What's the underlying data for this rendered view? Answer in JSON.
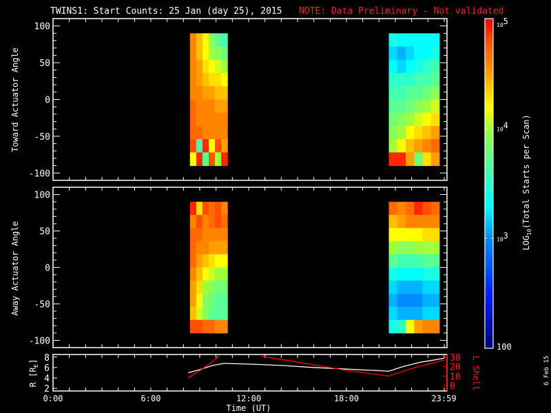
{
  "title": {
    "main": "TWINS1: Start Counts: 25 Jan (day  25), 2015",
    "note": "NOTE: Data Preliminary - Not validated"
  },
  "side_date": "6 Feb 15",
  "colors": {
    "axis": "#ffffff",
    "lshell": "#ff0000",
    "background": "#000000"
  },
  "chart_data": [
    {
      "type": "heatmap",
      "name": "toward",
      "ylabel": "Toward Actuator Angle",
      "ylim": [
        -110,
        110
      ],
      "yticks": [
        -100,
        -50,
        0,
        50,
        100
      ],
      "xlim": [
        0,
        24
      ],
      "angle_bins": [
        90,
        72,
        54,
        36,
        18,
        0,
        -18,
        -36,
        -54,
        -72,
        -90
      ],
      "blocks": [
        {
          "t_start": 8.4,
          "t_end": 10.7,
          "log_values": [
            [
              4.6,
              4.4,
              4.2,
              3.9,
              3.7,
              3.6
            ],
            [
              4.6,
              4.4,
              4.2,
              4.0,
              3.9,
              3.8
            ],
            [
              4.6,
              4.5,
              4.3,
              4.2,
              4.1,
              4.0
            ],
            [
              4.6,
              4.5,
              4.4,
              4.3,
              4.3,
              4.2
            ],
            [
              4.6,
              4.6,
              4.5,
              4.5,
              4.4,
              4.4
            ],
            [
              4.7,
              4.6,
              4.6,
              4.6,
              4.5,
              4.5
            ],
            [
              4.7,
              4.6,
              4.6,
              4.6,
              4.6,
              4.6
            ],
            [
              4.7,
              4.7,
              4.6,
              4.6,
              4.6,
              4.6
            ],
            [
              4.8,
              3.6,
              4.9,
              4.2,
              4.8,
              4.5
            ],
            [
              4.2,
              4.9,
              3.7,
              4.8,
              4.0,
              4.9
            ]
          ]
        },
        {
          "t_start": 20.6,
          "t_end": 23.7,
          "log_values": [
            [
              3.4,
              3.3,
              3.3,
              3.3,
              3.3,
              3.3
            ],
            [
              3.2,
              3.1,
              3.2,
              3.3,
              3.3,
              3.4
            ],
            [
              3.3,
              3.2,
              3.3,
              3.4,
              3.5,
              3.6
            ],
            [
              3.5,
              3.5,
              3.5,
              3.6,
              3.6,
              3.7
            ],
            [
              3.6,
              3.6,
              3.7,
              3.7,
              3.8,
              3.9
            ],
            [
              3.7,
              3.7,
              3.8,
              3.9,
              4.0,
              4.1
            ],
            [
              3.8,
              3.9,
              4.0,
              4.1,
              4.2,
              4.3
            ],
            [
              3.9,
              4.0,
              4.2,
              4.3,
              4.4,
              4.5
            ],
            [
              4.0,
              4.2,
              4.4,
              4.5,
              4.6,
              4.7
            ],
            [
              4.9,
              4.9,
              4.5,
              3.8,
              4.3,
              4.5
            ]
          ]
        }
      ]
    },
    {
      "type": "heatmap",
      "name": "away",
      "ylabel": "Away Actuator Angle",
      "ylim": [
        -110,
        110
      ],
      "yticks": [
        -100,
        -50,
        0,
        50,
        100
      ],
      "xlim": [
        0,
        24
      ],
      "angle_bins": [
        90,
        72,
        54,
        36,
        18,
        0,
        -18,
        -36,
        -54,
        -72,
        -90
      ],
      "blocks": [
        {
          "t_start": 8.4,
          "t_end": 10.7,
          "log_values": [
            [
              4.9,
              4.3,
              4.8,
              4.7,
              4.8,
              4.6
            ],
            [
              4.6,
              4.8,
              4.6,
              4.7,
              4.8,
              4.7
            ],
            [
              4.7,
              4.7,
              4.6,
              4.6,
              4.6,
              4.6
            ],
            [
              4.7,
              4.6,
              4.6,
              4.5,
              4.5,
              4.5
            ],
            [
              4.7,
              4.5,
              4.4,
              4.3,
              4.2,
              4.2
            ],
            [
              4.6,
              4.4,
              4.2,
              4.1,
              4.0,
              4.0
            ],
            [
              4.5,
              4.3,
              4.0,
              3.9,
              3.8,
              3.8
            ],
            [
              4.5,
              4.2,
              3.9,
              3.8,
              3.7,
              3.7
            ],
            [
              4.4,
              4.1,
              3.9,
              3.7,
              3.7,
              3.7
            ],
            [
              4.8,
              4.8,
              4.7,
              4.7,
              4.6,
              4.6
            ]
          ]
        },
        {
          "t_start": 20.6,
          "t_end": 23.7,
          "log_values": [
            [
              4.7,
              4.6,
              4.7,
              4.9,
              4.8,
              4.7
            ],
            [
              4.4,
              4.5,
              4.6,
              4.6,
              4.6,
              4.6
            ],
            [
              4.2,
              4.2,
              4.2,
              4.2,
              4.3,
              4.3
            ],
            [
              4.0,
              3.9,
              3.9,
              4.0,
              4.0,
              4.0
            ],
            [
              3.7,
              3.6,
              3.6,
              3.6,
              3.7,
              3.7
            ],
            [
              3.4,
              3.3,
              3.3,
              3.3,
              3.4,
              3.4
            ],
            [
              3.2,
              3.1,
              3.1,
              3.1,
              3.2,
              3.2
            ],
            [
              3.1,
              3.0,
              3.0,
              3.0,
              3.1,
              3.1
            ],
            [
              3.2,
              3.1,
              3.1,
              3.1,
              3.2,
              3.2
            ],
            [
              3.4,
              3.5,
              4.2,
              4.5,
              4.6,
              4.6
            ]
          ]
        }
      ]
    },
    {
      "type": "line",
      "name": "ephemeris",
      "xlabel": "Time (UT)",
      "xticks": [
        "0:00",
        "6:00",
        "12:00",
        "18:00",
        "23:59"
      ],
      "xtick_values": [
        0,
        6,
        12,
        18,
        23.98
      ],
      "xlim": [
        0,
        24
      ],
      "ylabel": "R [RE]",
      "ylabel_main": "R [R",
      "ylabel_sub": "E",
      "ylabel_end": "]",
      "ylim": [
        1.5,
        8.5
      ],
      "yticks": [
        2,
        4,
        6,
        8
      ],
      "y2label": "L Shell",
      "y2lim": [
        0,
        31
      ],
      "y2ticks": [
        0,
        10,
        20,
        30
      ],
      "series": [
        {
          "name": "R",
          "axis": "left",
          "color": "#ffffff",
          "x": [
            8.3,
            9.0,
            9.8,
            10.5,
            11.5,
            12.5,
            14,
            16,
            18,
            20.0,
            20.6,
            21.5,
            22.5,
            23.3,
            24.0
          ],
          "y": [
            5.0,
            5.6,
            6.4,
            6.8,
            6.7,
            6.6,
            6.4,
            6.0,
            5.7,
            5.4,
            5.3,
            6.2,
            7.0,
            7.4,
            7.8
          ]
        },
        {
          "name": "L Shell",
          "axis": "right",
          "color": "#ff0000",
          "segments": [
            {
              "x": [
                8.3,
                9.2,
                10.2
              ],
              "y": [
                8,
                18,
                31
              ]
            },
            {
              "x": [
                12.8,
                16,
                18,
                20.6,
                22,
                24.0
              ],
              "y": [
                31,
                22,
                16,
                10,
                18,
                27
              ]
            }
          ]
        }
      ]
    },
    {
      "type": "colorbar",
      "label_main": "LOG",
      "label_sub": "10",
      "label_end": "(Total Starts per Scan)",
      "log_range": [
        2,
        5
      ],
      "tick_labels": [
        {
          "log": 5,
          "base": "10",
          "exp": "5"
        },
        {
          "log": 4,
          "base": "10",
          "exp": "4"
        },
        {
          "log": 3,
          "base": "10",
          "exp": "3"
        },
        {
          "log": 2,
          "base": "100",
          "exp": ""
        }
      ]
    }
  ]
}
